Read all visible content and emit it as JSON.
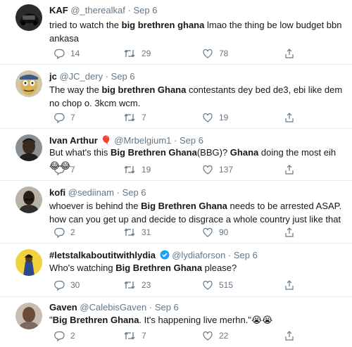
{
  "tweets": [
    {
      "name": "KAF",
      "handle": "@_therealkaf",
      "time": "Sep 6",
      "avatar": "dark-car-avatar",
      "body": [
        {
          "t": "tried to watch the ",
          "b": false
        },
        {
          "t": "big brethren ghana",
          "b": true
        },
        {
          "t": " lmao the thing be low budget bbn ankasa",
          "b": false
        }
      ],
      "replies": "14",
      "retweets": "29",
      "likes": "78"
    },
    {
      "name": "jc",
      "handle": "@JC_dery",
      "time": "Sep 6",
      "avatar": "cartoon-face-avatar",
      "body": [
        {
          "t": "The way the ",
          "b": false
        },
        {
          "t": "big brethren Ghana",
          "b": true
        },
        {
          "t": " contestants dey bed de3, ebi like dem no chop o. 3kcm wcm.",
          "b": false
        }
      ],
      "replies": "7",
      "retweets": "7",
      "likes": "19"
    },
    {
      "name": "Ivan Arthur",
      "name_emoji": "🎈",
      "handle": "@Mrbelgium1",
      "time": "Sep 6",
      "avatar": "man-portrait-avatar",
      "body": [
        {
          "t": "But what's this ",
          "b": false
        },
        {
          "t": "Big Brethren Ghana",
          "b": true
        },
        {
          "t": "(BBG)? ",
          "b": false
        },
        {
          "t": "Ghana",
          "b": true
        },
        {
          "t": " doing the most eih😂😂",
          "b": false
        }
      ],
      "replies": "7",
      "retweets": "19",
      "likes": "137"
    },
    {
      "name": "kofi",
      "handle": "@sediinam",
      "time": "Sep 6",
      "avatar": "man-portrait-avatar",
      "body": [
        {
          "t": "whoever is behind the ",
          "b": false
        },
        {
          "t": "Big Brethren Ghana",
          "b": true
        },
        {
          "t": " needs to be arrested ASAP. how can you get up and decide to disgrace a whole country just like that",
          "b": false
        }
      ],
      "replies": "2",
      "retweets": "31",
      "likes": "90"
    },
    {
      "name": "#letstalkaboutitwithlydia",
      "verified": true,
      "handle": "@lydiaforson",
      "time": "Sep 6",
      "avatar": "yellow-illustration-avatar",
      "body": [
        {
          "t": "Who's watching ",
          "b": false
        },
        {
          "t": "Big Brethren Ghana",
          "b": true
        },
        {
          "t": " please?",
          "b": false
        }
      ],
      "replies": "30",
      "retweets": "23",
      "likes": "515"
    },
    {
      "name": "Gaven",
      "handle": "@CalebisGaven",
      "time": "Sep 6",
      "avatar": "man-portrait-avatar",
      "body": [
        {
          "t": "\"",
          "b": false
        },
        {
          "t": "Big Brethren Ghana",
          "b": true
        },
        {
          "t": ". It's happening live merhn.\"😭😭",
          "b": false
        }
      ],
      "replies": "2",
      "retweets": "7",
      "likes": "22"
    }
  ],
  "colors": {
    "text": "#14171a",
    "muted": "#657786",
    "verified": "#1da1f2",
    "divider": "#e6ecf0"
  }
}
